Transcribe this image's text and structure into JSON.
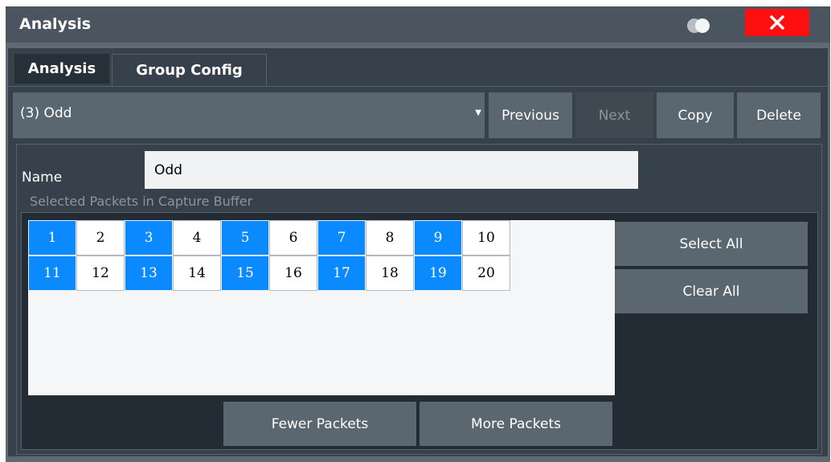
{
  "window": {
    "title": "Analysis",
    "toggle_icon": "theme-toggle-icon",
    "close_icon": "close-icon",
    "close_color": "#ff1010"
  },
  "tabs": [
    {
      "label": "Analysis",
      "active": false
    },
    {
      "label": "Group Config",
      "active": true
    }
  ],
  "group_select": {
    "value": "(3) Odd",
    "caret_icon": "caret-down-icon"
  },
  "buttons": {
    "previous": "Previous",
    "next": "Next",
    "copy": "Copy",
    "delete": "Delete",
    "select_all": "Select All",
    "clear_all": "Clear All",
    "fewer_packets": "Fewer Packets",
    "more_packets": "More Packets"
  },
  "name": {
    "label": "Name",
    "value": "Odd"
  },
  "packets": {
    "section_label": "Selected Packets in Capture Buffer",
    "selected_color": "#0b8aff",
    "rows": [
      [
        {
          "num": "1",
          "selected": true
        },
        {
          "num": "2",
          "selected": false
        },
        {
          "num": "3",
          "selected": true
        },
        {
          "num": "4",
          "selected": false
        },
        {
          "num": "5",
          "selected": true
        },
        {
          "num": "6",
          "selected": false
        },
        {
          "num": "7",
          "selected": true
        },
        {
          "num": "8",
          "selected": false
        },
        {
          "num": "9",
          "selected": true
        },
        {
          "num": "10",
          "selected": false
        }
      ],
      [
        {
          "num": "11",
          "selected": true
        },
        {
          "num": "12",
          "selected": false
        },
        {
          "num": "13",
          "selected": true
        },
        {
          "num": "14",
          "selected": false
        },
        {
          "num": "15",
          "selected": true
        },
        {
          "num": "16",
          "selected": false
        },
        {
          "num": "17",
          "selected": true
        },
        {
          "num": "18",
          "selected": false
        },
        {
          "num": "19",
          "selected": true
        },
        {
          "num": "20",
          "selected": false
        }
      ]
    ]
  }
}
